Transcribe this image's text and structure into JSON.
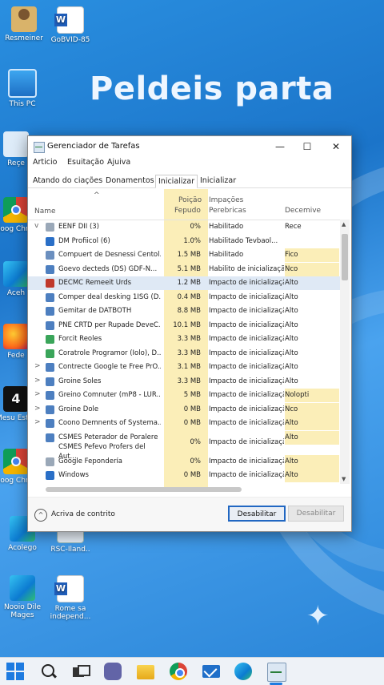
{
  "desktop": {
    "wallpaper_title": "Peldeis parta",
    "icons": [
      {
        "label": "Resmeiner",
        "icon": "user-folder-icon"
      },
      {
        "label": "GoBVID-85",
        "icon": "word-document-icon"
      },
      {
        "label": "This PC",
        "icon": "this-pc-icon"
      },
      {
        "label": "Reçe",
        "icon": "recycle-bin-icon"
      },
      {
        "label": "Goog Chron",
        "icon": "chrome-icon"
      },
      {
        "label": "Aceh",
        "icon": "edge-icon"
      },
      {
        "label": "Fede",
        "icon": "firefox-icon"
      },
      {
        "label": "Mesu Ester",
        "icon": "tile-icon"
      },
      {
        "label": "Goog Chron",
        "icon": "chrome-icon"
      },
      {
        "label": "Acolego",
        "icon": "edge-icon"
      },
      {
        "label": "RSC-Iland..",
        "icon": "app-icon"
      },
      {
        "label": "Nooio Dile Mages",
        "icon": "edge-icon"
      },
      {
        "label": "Rome sa independ...",
        "icon": "word-document-icon"
      }
    ],
    "tile_text": "4"
  },
  "window": {
    "title": "Gerenciador de Tarefas",
    "controls": {
      "minimize": "—",
      "maximize": "☐",
      "close": "✕"
    },
    "menu": [
      "Articio",
      "Esuitação",
      "Ajuiva"
    ],
    "tabs": [
      "Atando do ciações",
      "Donamentos",
      "Inicializar",
      "Inicializar"
    ],
    "active_tab": 2,
    "columns": {
      "sort_arrow": "^",
      "name": "Name",
      "memory_line1": "Poição",
      "memory_line2": "Fepudo",
      "impact_line1": "Impações",
      "impact_line2": "Perebricas",
      "decline": "Decemive"
    },
    "rows": [
      {
        "expander": "v",
        "name": "EENF DII (3)",
        "memory": "0%",
        "impact": "Habilitado",
        "decline": "Rece",
        "icon_color": "#9aa8b8",
        "decline_hl": false,
        "selected": false
      },
      {
        "expander": "",
        "name": "DM Profiicol (6)",
        "memory": "1.0%",
        "impact": "Habilitado Tevbaol...",
        "decline": "",
        "icon_color": "#2a6fc7",
        "decline_hl": false,
        "selected": false
      },
      {
        "expander": "",
        "name": "Compuert de Desnessi Centol...",
        "memory": "1.5 MB",
        "impact": "Habilitado",
        "decline": "Fico",
        "icon_color": "#6b8fbf",
        "decline_hl": true,
        "selected": false
      },
      {
        "expander": "",
        "name": "Goevo decteds (DS) GDF-N...",
        "memory": "5.1 MB",
        "impact": "Habilito de inicialização...",
        "decline": "Nco",
        "icon_color": "#4d7fc0",
        "decline_hl": true,
        "selected": false
      },
      {
        "expander": "",
        "name": "DECMC Remeeit Urds",
        "memory": "1.2 MB",
        "impact": "Impacto de inicialização",
        "decline": "Alto",
        "icon_color": "#c0392b",
        "decline_hl": false,
        "selected": true
      },
      {
        "expander": "",
        "name": "Comper deal desking 1ISG (D...",
        "memory": "0.4 MB",
        "impact": "Impacto de inicialização",
        "decline": "Alto",
        "icon_color": "#4d7fc0",
        "decline_hl": false,
        "selected": false
      },
      {
        "expander": "",
        "name": "Gemitar de DATBOTH",
        "memory": "8.8 MB",
        "impact": "Impacto de inicialização",
        "decline": "Alto",
        "icon_color": "#4d7fc0",
        "decline_hl": false,
        "selected": false
      },
      {
        "expander": "",
        "name": "PNE CRTD per Rupade DeveC...",
        "memory": "10.1 MB",
        "impact": "Impacto de inicialização",
        "decline": "Alto",
        "icon_color": "#4d7fc0",
        "decline_hl": false,
        "selected": false
      },
      {
        "expander": "",
        "name": "Forcit Reoles",
        "memory": "3.3 MB",
        "impact": "Impacto de inicialização",
        "decline": "Alto",
        "icon_color": "#3aa55a",
        "decline_hl": false,
        "selected": false
      },
      {
        "expander": "",
        "name": "Coratrole Programor (Iolo), D...",
        "memory": "3.3 MB",
        "impact": "Impacto de inicialização",
        "decline": "Alto",
        "icon_color": "#3aa55a",
        "decline_hl": false,
        "selected": false
      },
      {
        "expander": ">",
        "name": "Contrecte Google te Free PrO...",
        "memory": "3.1 MB",
        "impact": "Impacto de inicialização",
        "decline": "Alto",
        "icon_color": "#4d7fc0",
        "decline_hl": false,
        "selected": false
      },
      {
        "expander": ">",
        "name": "Groine Soles",
        "memory": "3.3 MB",
        "impact": "Impacto de inicialização",
        "decline": "Alto",
        "icon_color": "#4d7fc0",
        "decline_hl": false,
        "selected": false
      },
      {
        "expander": ">",
        "name": "Greino Comnuter (mP8 - LUR...",
        "memory": "5 MB",
        "impact": "Impacto de inicialização",
        "decline": "Nolopti",
        "icon_color": "#4d7fc0",
        "decline_hl": true,
        "selected": false
      },
      {
        "expander": ">",
        "name": "Groine Dole",
        "memory": "0 MB",
        "impact": "Impacto de inicialização",
        "decline": "Nco",
        "icon_color": "#4d7fc0",
        "decline_hl": true,
        "selected": false
      },
      {
        "expander": ">",
        "name": "Coono Demnents of Systema...",
        "memory": "0 MB",
        "impact": "Impacto de inicialização",
        "decline": "Alto",
        "icon_color": "#4d7fc0",
        "decline_hl": true,
        "selected": false
      },
      {
        "expander": "",
        "name": "CSMES Peterador de Poralere CSMES Pefevo Profers del Aut...",
        "memory": "0%",
        "impact": "Impacto de inicialização",
        "decline": "Alto",
        "icon_color": "#4d7fc0",
        "decline_hl": true,
        "selected": false,
        "tall": true
      },
      {
        "expander": "",
        "name": "Google Fepondería",
        "memory": "0%",
        "impact": "Impacto de inicialização",
        "decline": "Alto",
        "icon_color": "#9aa8b8",
        "decline_hl": true,
        "selected": false
      },
      {
        "expander": "",
        "name": "Windows",
        "memory": "0 MB",
        "impact": "Impacto de inicialização",
        "decline": "Alto",
        "icon_color": "#2a6fc7",
        "decline_hl": true,
        "selected": false
      }
    ],
    "footer": {
      "toggle_symbol": "^",
      "fewer_details": "Acriva de contrito",
      "disable_primary": "Desabilitar",
      "disable_secondary": "Desabilitar"
    }
  },
  "taskbar": {
    "items": [
      "start-icon",
      "search-icon",
      "task-view-icon",
      "teams-chat-icon",
      "file-explorer-icon",
      "chrome-icon",
      "mail-icon",
      "edge-icon",
      "task-manager-icon"
    ]
  },
  "colors": {
    "wallpaper": "#2a8fe0",
    "highlight_column": "#fbeeb8",
    "selected_row": "#dfe9f5",
    "primary_button_border": "#2167c2"
  }
}
